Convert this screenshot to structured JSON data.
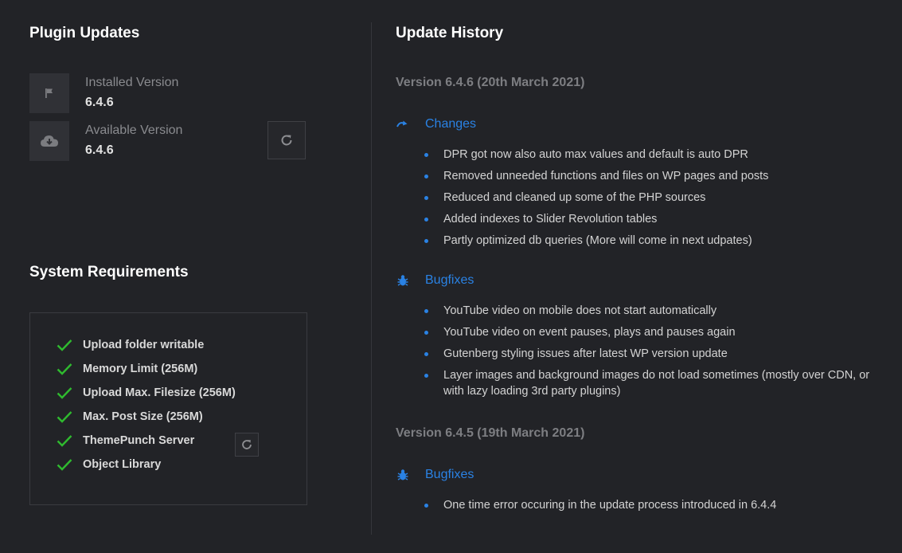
{
  "plugin_updates": {
    "title": "Plugin Updates",
    "installed_label": "Installed Version",
    "installed_value": "6.4.6",
    "available_label": "Available Version",
    "available_value": "6.4.6"
  },
  "system_requirements": {
    "title": "System Requirements",
    "items": [
      "Upload folder writable",
      "Memory Limit (256M)",
      "Upload Max. Filesize (256M)",
      "Max. Post Size (256M)",
      "ThemePunch Server",
      "Object Library"
    ]
  },
  "update_history": {
    "title": "Update History",
    "versions": [
      {
        "title": "Version 6.4.6 (20th March 2021)",
        "sections": [
          {
            "label": "Changes",
            "icon": "changes-icon",
            "items": [
              "DPR got now also auto max values and default is auto DPR",
              "Removed unneeded functions and files on WP pages and posts",
              "Reduced and cleaned up some of the PHP sources",
              "Added indexes to Slider Revolution tables",
              "Partly optimized db queries (More will come in next udpates)"
            ]
          },
          {
            "label": "Bugfixes",
            "icon": "bug-icon",
            "items": [
              "YouTube video on mobile does not start automatically",
              "YouTube video on event pauses, plays and pauses again",
              "Gutenberg styling issues after latest WP version update",
              "Layer images and background images do not load sometimes (mostly over CDN, or with lazy loading 3rd party plugins)"
            ]
          }
        ]
      },
      {
        "title": "Version 6.4.5 (19th March 2021)",
        "sections": [
          {
            "label": "Bugfixes",
            "icon": "bug-icon",
            "items": [
              "One time error occuring in the update process introduced in 6.4.4"
            ]
          }
        ]
      }
    ]
  },
  "colors": {
    "background": "#222327",
    "accent": "#2a82e4",
    "check": "#2fba2f"
  }
}
